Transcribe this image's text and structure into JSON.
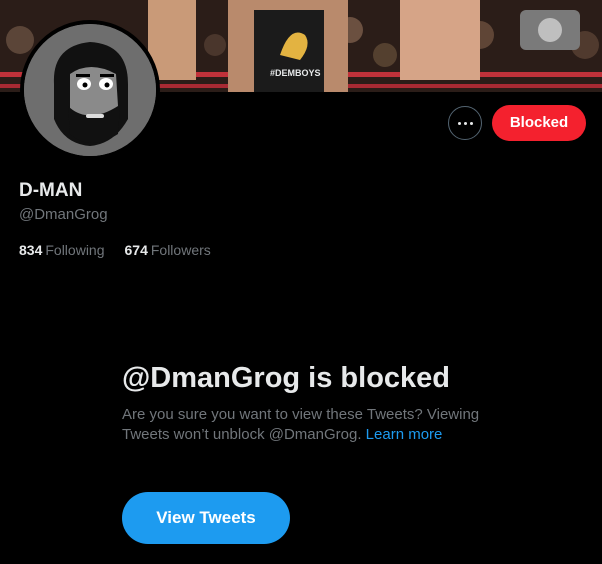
{
  "profile": {
    "display_name": "D-MAN",
    "handle": "@DmanGrog",
    "following_count": "834",
    "following_label": "Following",
    "followers_count": "674",
    "followers_label": "Followers"
  },
  "banner": {
    "shirt_text": "#DEMBOYS"
  },
  "actions": {
    "more_icon": "more-horizontal-icon",
    "blocked_label": "Blocked"
  },
  "blocked_notice": {
    "title": "@DmanGrog is blocked",
    "description": "Are you sure you want to view these Tweets? Viewing Tweets won’t unblock @DmanGrog.",
    "learn_more": "Learn more",
    "view_button": "View Tweets"
  },
  "colors": {
    "background": "#000000",
    "blocked_red": "#f4212e",
    "accent_blue": "#1d9bf0",
    "secondary_text": "#71767b"
  }
}
